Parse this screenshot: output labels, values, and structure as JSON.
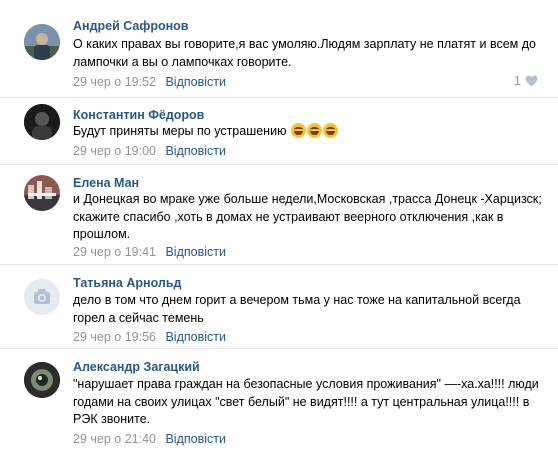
{
  "comments": [
    {
      "author": "Андрей Сафронов",
      "text": "О каких правах вы говорите,я вас умоляю.Людям зарплату не платят и всем до лампочки а вы о лампочках говорите.",
      "date": "29 чер о 19:52",
      "reply": "Відповісти",
      "likes": "1",
      "avatar_icon": "person-photo-icon"
    },
    {
      "author": "Константин Фёдоров",
      "text": "Будут приняты меры по устрашению",
      "emojis": [
        "laughing-emoji",
        "laughing-emoji",
        "laughing-emoji"
      ],
      "date": "29 чер о 19:00",
      "reply": "Відповісти",
      "avatar_icon": "dark-person-icon"
    },
    {
      "author": "Елена Ман",
      "text": "и Донецкая во мраке уже больше недели,Московская ,трасса Донецк -Харцизск; скажите спасибо ,хоть в домах не устраивают веерного отключения ,как в прошлом.",
      "date": "29 чер о 19:41",
      "reply": "Відповісти",
      "avatar_icon": "city-photo-icon"
    },
    {
      "author": "Татьяна Арнольд",
      "text": "дело в том что днем горит а вечером тьма у нас тоже на капитальной всегда горел а сейчас темень",
      "date": "29 чер о 19:56",
      "reply": "Відповісти",
      "avatar_icon": "camera-placeholder-icon"
    },
    {
      "author": "Александр Загацкий",
      "text": "\"нарушает права граждан на безопасные условия проживания\" —-ха.ха!!!! люди годами на своих улицах \"свет белый\" не видят!!!! а тут центральная улица!!!! в РЭК звоните.",
      "date": "29 чер о 21:40",
      "reply": "Відповісти",
      "avatar_icon": "eye-photo-icon"
    }
  ],
  "colors": {
    "author": "#2a5885",
    "reply": "#2a5885",
    "date": "#939393",
    "divider": "#e7e8ec"
  }
}
